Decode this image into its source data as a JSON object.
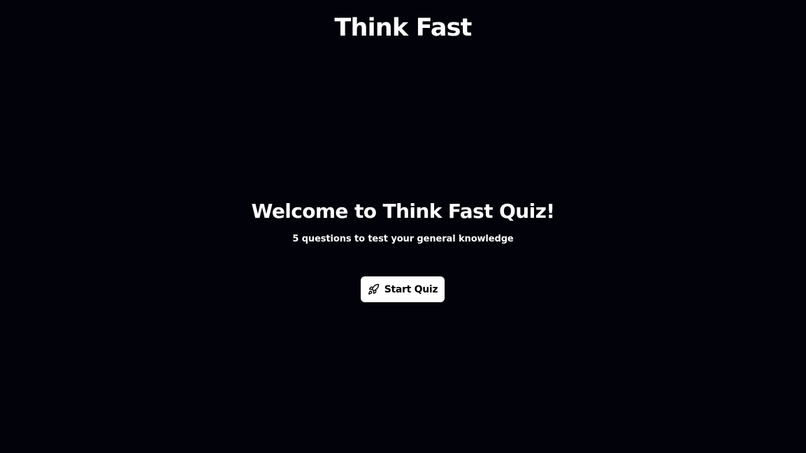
{
  "header": {
    "title": "Think Fast"
  },
  "welcome": {
    "title": "Welcome to Think Fast Quiz!",
    "subtitle": "5 questions to test your general knowledge"
  },
  "start_button": {
    "label": "Start Quiz",
    "icon": "rocket-icon"
  },
  "colors": {
    "background": "#02020a",
    "text": "#ffffff",
    "button_background": "#ffffff",
    "button_text": "#000000"
  }
}
